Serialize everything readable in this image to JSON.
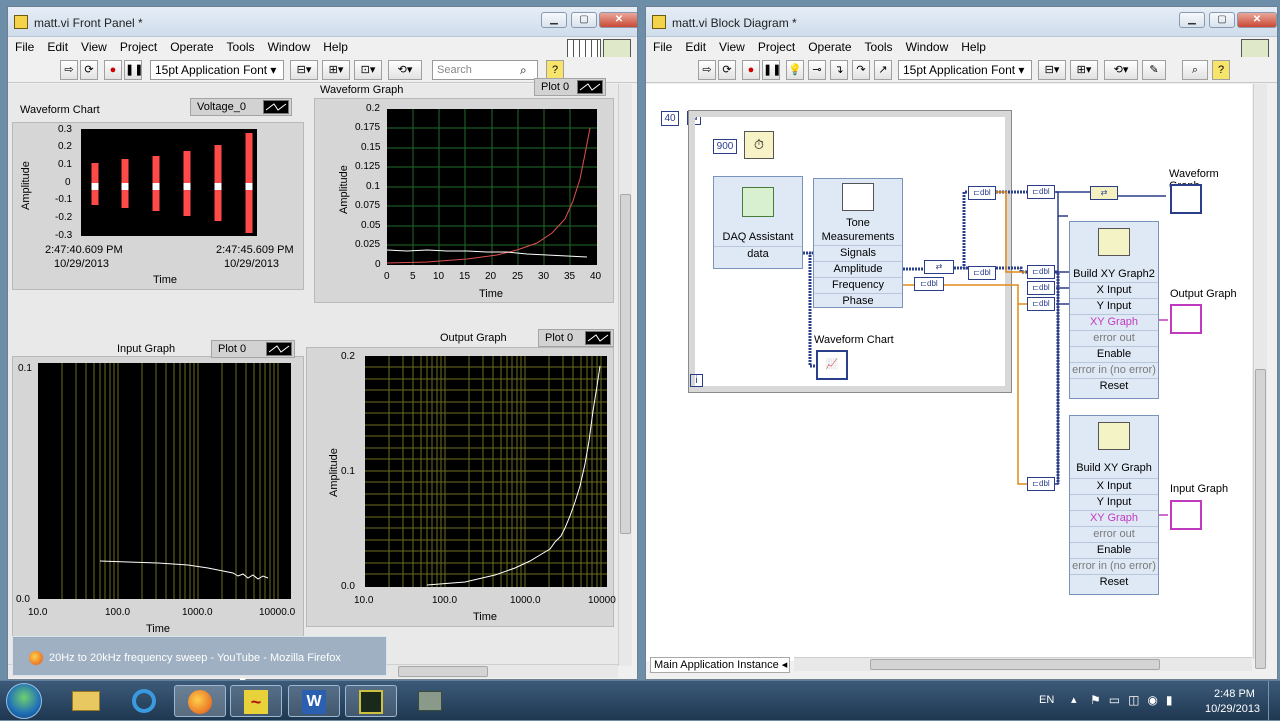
{
  "front_panel": {
    "title": "matt.vi Front Panel *",
    "menu": [
      "File",
      "Edit",
      "View",
      "Project",
      "Operate",
      "Tools",
      "Window",
      "Help"
    ],
    "font": "15pt Application Font",
    "search_placeholder": "Search",
    "waveform_chart": {
      "label": "Waveform Chart",
      "legend": "Voltage_0",
      "ylabel": "Amplitude",
      "xlabel": "Time",
      "yticks": [
        "0.3",
        "0.2",
        "0.1",
        "0",
        "-0.1",
        "-0.2",
        "-0.3"
      ],
      "start_time": "2:47:40.609 PM",
      "start_date": "10/29/2013",
      "end_time": "2:47:45.609 PM",
      "end_date": "10/29/2013"
    },
    "waveform_graph": {
      "label": "Waveform Graph",
      "legend": "Plot 0",
      "ylabel": "Amplitude",
      "xlabel": "Time",
      "yticks": [
        "0.2",
        "0.175",
        "0.15",
        "0.125",
        "0.1",
        "0.075",
        "0.05",
        "0.025",
        "0"
      ],
      "xticks": [
        "0",
        "5",
        "10",
        "15",
        "20",
        "25",
        "30",
        "35",
        "40"
      ]
    },
    "input_graph": {
      "label": "Input Graph",
      "legend": "Plot 0",
      "xlabel": "Time",
      "yticks": [
        "0.1",
        "0.0"
      ],
      "xticks": [
        "10.0",
        "100.0",
        "1000.0",
        "10000.0"
      ]
    },
    "output_graph": {
      "label": "Output Graph",
      "legend": "Plot 0",
      "ylabel": "Amplitude",
      "xlabel": "Time",
      "yticks": [
        "0.2",
        "0.1",
        "0.0"
      ],
      "xticks": [
        "10.0",
        "100.0",
        "1000.0",
        "10000"
      ]
    }
  },
  "block_diagram": {
    "title": "matt.vi Block Diagram *",
    "menu": [
      "File",
      "Edit",
      "View",
      "Project",
      "Operate",
      "Tools",
      "Window",
      "Help"
    ],
    "font": "15pt Application Font",
    "loop_count": "40",
    "loop_n": "N",
    "loop_i": "i",
    "wait_ms": "900",
    "daq": {
      "title": "DAQ Assistant",
      "output": "data"
    },
    "tone": {
      "title1": "Tone",
      "title2": "Measurements",
      "rows": [
        "Signals",
        "Amplitude",
        "Frequency",
        "Phase"
      ]
    },
    "xy1": {
      "title": "Build XY Graph2",
      "rows": [
        "X Input",
        "Y Input",
        "XY Graph",
        "error out",
        "Enable",
        "error in (no error)",
        "Reset"
      ]
    },
    "xy2": {
      "title": "Build XY Graph",
      "rows": [
        "X Input",
        "Y Input",
        "XY Graph",
        "error out",
        "Enable",
        "error in (no error)",
        "Reset"
      ]
    },
    "labels": {
      "waveform_chart": "Waveform Chart",
      "waveform_graph": "Waveform Graph",
      "output_graph": "Output Graph",
      "input_graph": "Input Graph"
    },
    "status": "Main Application Instance"
  },
  "notification": "20Hz to 20kHz frequency sweep - YouTube - Mozilla Firefox",
  "taskbar": {
    "lang": "EN",
    "time": "2:48 PM",
    "date": "10/29/2013"
  }
}
